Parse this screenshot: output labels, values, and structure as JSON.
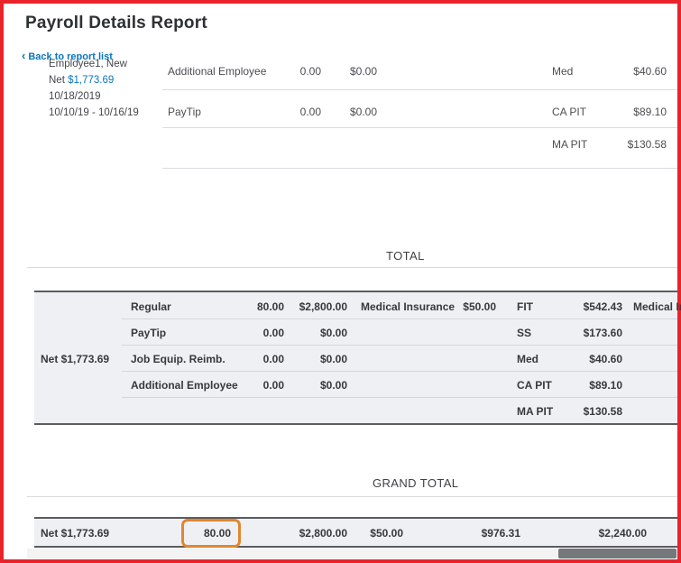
{
  "header": {
    "title": "Payroll Details Report",
    "back_icon": "‹",
    "back_link": "Back to report list"
  },
  "employee": {
    "name": "Employee1, New",
    "net_label": "Net",
    "net_value": "$1,773.69",
    "check_date": "10/18/2019",
    "pay_period": "10/10/19 -  10/16/19",
    "pay_rows": [
      {
        "label": "Additional Employee",
        "hours": "0.00",
        "amount": "$0.00"
      },
      {
        "label": "PayTip",
        "hours": "0.00",
        "amount": "$0.00"
      }
    ],
    "tax_rows": [
      {
        "label": "Med",
        "amount": "$40.60"
      },
      {
        "label": "CA PIT",
        "amount": "$89.10"
      },
      {
        "label": "MA PIT",
        "amount": "$130.58"
      }
    ]
  },
  "total": {
    "heading": "TOTAL",
    "net": "Net $1,773.69",
    "rows": [
      {
        "pay": "Regular",
        "hours": "80.00",
        "amount": "$2,800.00",
        "ded_label": "Medical Insurance",
        "ded_amount": "$50.00",
        "tax": "FIT",
        "tax_amount": "$542.43",
        "clipped": "Medical In"
      },
      {
        "pay": "PayTip",
        "hours": "0.00",
        "amount": "$0.00",
        "tax": "SS",
        "tax_amount": "$173.60"
      },
      {
        "pay": "Job Equip. Reimb.",
        "hours": "0.00",
        "amount": "$0.00",
        "tax": "Med",
        "tax_amount": "$40.60"
      },
      {
        "pay": "Additional Employee",
        "hours": "0.00",
        "amount": "$0.00",
        "tax": "CA PIT",
        "tax_amount": "$89.10"
      },
      {
        "tax": "MA PIT",
        "tax_amount": "$130.58"
      }
    ]
  },
  "grand_total": {
    "heading": "GRAND TOTAL",
    "net": "Net $1,773.69",
    "hours": "80.00",
    "gross": "$2,800.00",
    "deductions": "$50.00",
    "taxes": "$976.31",
    "net_pay": "$2,240.00"
  },
  "colors": {
    "accent_blue": "#0c75bc",
    "highlight_orange": "#e2862e",
    "frame_red": "#e8242a"
  }
}
